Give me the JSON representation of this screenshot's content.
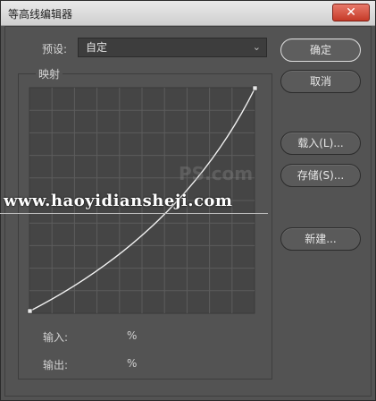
{
  "window": {
    "title": "等高线编辑器",
    "close_glyph": "✕"
  },
  "preset": {
    "label": "预设:",
    "value": "自定"
  },
  "mapping": {
    "label": "映射"
  },
  "fields": {
    "input_label": "输入:",
    "input_unit": "%",
    "output_label": "输出:",
    "output_unit": "%"
  },
  "buttons": {
    "ok": "确定",
    "cancel": "取消",
    "load": "载入(L)...",
    "save": "存储(S)...",
    "new": "新建..."
  },
  "watermark": {
    "text": "www.haoyidiansheji.com",
    "bg_text": "PS.com"
  },
  "colors": {
    "dialog_bg": "#535353",
    "grid_bg": "#454545",
    "grid_line": "#5c5c5c",
    "curve": "#f2f2f2"
  }
}
